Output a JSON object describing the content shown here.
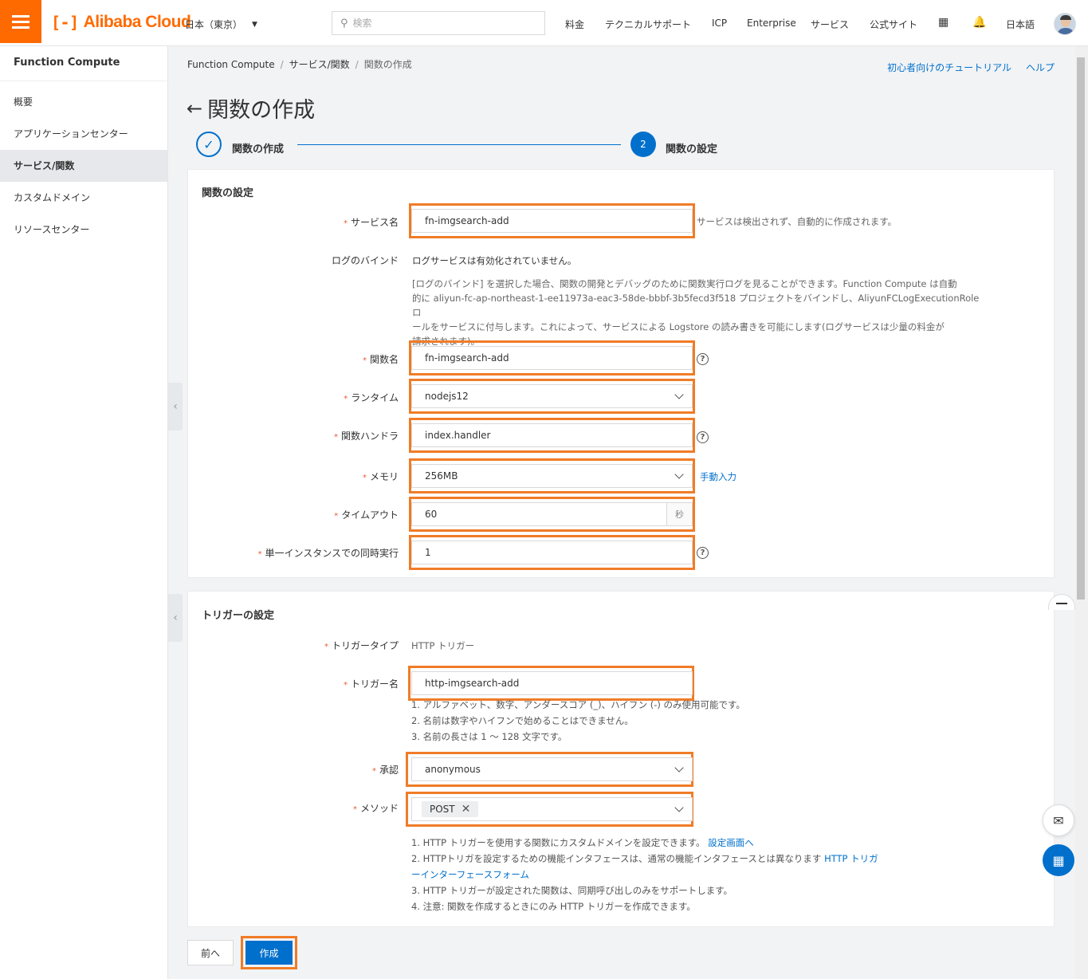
{
  "header": {
    "logo_text": "Alibaba Cloud",
    "region": "日本（東京）",
    "search_placeholder": "検索",
    "nav": [
      "料金",
      "テクニカルサポート",
      "ICP",
      "Enterprise",
      "サービス",
      "公式サイト"
    ],
    "language": "日本語",
    "accent_color": "#ff6a00"
  },
  "sidebar": {
    "title": "Function Compute",
    "items": [
      {
        "label": "概要"
      },
      {
        "label": "アプリケーションセンター"
      },
      {
        "label": "サービス/関数"
      },
      {
        "label": "カスタムドメイン"
      },
      {
        "label": "リソースセンター"
      }
    ],
    "active_index": 2
  },
  "breadcrumb": [
    "Function Compute",
    "サービス/関数",
    "関数の作成"
  ],
  "top_links": {
    "tutorial": "初心者向けのチュートリアル",
    "help": "ヘルプ"
  },
  "page_title": "関数の作成",
  "steps": [
    {
      "label": "関数の作成",
      "status": "done"
    },
    {
      "number": "2",
      "label": "関数の設定",
      "status": "current"
    }
  ],
  "function_settings": {
    "title": "関数の設定",
    "service_name": {
      "label": "サービス名",
      "value": "fn-imgsearch-add",
      "hint": "サービスは検出されず、自動的に作成されます。"
    },
    "log_binding": {
      "label": "ログのバインド",
      "status": "ログサービスは有効化されていません。",
      "description_lines": [
        "[ログのバインド] を選択した場合、関数の開発とデバッグのために関数実行ログを見ることができます。Function Compute は自動",
        "的に aliyun-fc-ap-northeast-1-ee11973a-eac3-58de-bbbf-3b5fecd3f518 プロジェクトをバインドし、AliyunFCLogExecutionRole ロ",
        "ールをサービスに付与します。これによって、サービスによる Logstore の読み書きを可能にします(ログサービスは少量の料金が",
        "請求されます)。"
      ]
    },
    "function_name": {
      "label": "関数名",
      "value": "fn-imgsearch-add"
    },
    "runtime": {
      "label": "ランタイム",
      "value": "nodejs12"
    },
    "handler": {
      "label": "関数ハンドラ",
      "value": "index.handler"
    },
    "memory": {
      "label": "メモリ",
      "value": "256MB",
      "manual_link": "手動入力"
    },
    "timeout": {
      "label": "タイムアウト",
      "value": "60",
      "unit": "秒"
    },
    "concurrency": {
      "label": "単一インスタンスでの同時実行",
      "value": "1"
    }
  },
  "trigger_settings": {
    "title": "トリガーの設定",
    "type": {
      "label": "トリガータイプ",
      "value": "HTTP トリガー"
    },
    "name": {
      "label": "トリガー名",
      "value": "http-imgsearch-add",
      "rules": [
        "1. アルファベット、数字、アンダースコア (_)、ハイフン (-) のみ使用可能です。",
        "2. 名前は数字やハイフンで始めることはできません。",
        "3. 名前の長さは 1 〜 128 文字です。"
      ]
    },
    "auth": {
      "label": "承認",
      "value": "anonymous"
    },
    "method": {
      "label": "メソッド",
      "tag": "POST"
    },
    "notes": {
      "n1": "1. HTTP トリガーを使用する関数にカスタムドメインを設定できます。",
      "n1_link": "設定画面へ",
      "n2": "2. HTTPトリガを設定するための機能インタフェースは、通常の機能インタフェースとは異なります",
      "n2_link_a": "HTTP トリガ",
      "n2_link_b": "ーインターフェースフォーム",
      "n3": "3. HTTP トリガーが設定された関数は、同期呼び出しのみをサポートします。",
      "n4": "4. 注意: 関数を作成するときにのみ HTTP トリガーを作成できます。"
    }
  },
  "buttons": {
    "prev": "前へ",
    "create": "作成"
  },
  "colors": {
    "primary": "#0070cc",
    "highlight": "#f07c27",
    "required": "#e85b35"
  }
}
